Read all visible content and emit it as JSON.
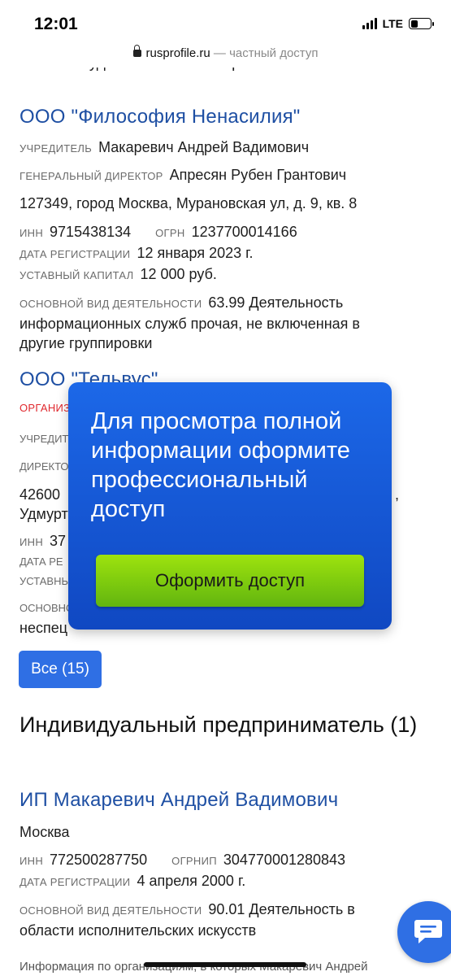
{
  "status_bar": {
    "time": "12:01",
    "network": "LTE",
    "battery_level": 0.35
  },
  "browser": {
    "domain": "rusprofile.ru",
    "separator": " — ",
    "access": "частный доступ"
  },
  "cut_text": "области художественного творчества",
  "companies": [
    {
      "title": "ООО \"Философия Ненасилия\"",
      "founder_label": "Учредитель",
      "founder": "Макаревич Андрей Вадимович",
      "director_label": "Генеральный директор",
      "director": "Апресян Рубен Грантович",
      "address": "127349, город Москва, Мурановская ул, д. 9, кв. 8",
      "inn_label": "ИНН",
      "inn": "9715438134",
      "ogrn_label": "ОГРН",
      "ogrn": "1237700014166",
      "reg_label": "Дата регистрации",
      "reg_date": "12 января 2023 г.",
      "capital_label": "Уставный капитал",
      "capital": "12 000 руб.",
      "activity_label": "Основной вид деятельности",
      "activity_line1": "63.99 Деятельность",
      "activity_line2": "информационных служб прочая, не включенная в",
      "activity_line3": "другие группировки"
    },
    {
      "title": "ООО \"Тельвус\"",
      "status_partial": "ОРГАНИЗ",
      "founder_partial": "УЧРЕДИТ",
      "director_partial": "ДИРЕКТО",
      "address_partial_1": "42600",
      "address_partial_2": "Удмурт",
      "address_tail": ",",
      "inn_label": "ИНН",
      "inn_partial": "37",
      "reg_partial": "ДАТА РЕ",
      "capital_partial": "УСТАВНЫ",
      "activity_partial": "ОСНОВНО",
      "activity_line_partial": "неспец"
    }
  ],
  "paywall": {
    "message": "Для просмотра полной информации оформите профессиональный доступ",
    "button": "Оформить доступ"
  },
  "all_button": "Все (15)",
  "ip_section": {
    "heading": "Индивидуальный предприниматель (1)",
    "title": "ИП Макаревич Андрей Вадимович",
    "city": "Москва",
    "inn_label": "ИНН",
    "inn": "772500287750",
    "ogrnip_label": "ОГРНИП",
    "ogrnip": "304770001280843",
    "reg_label": "Дата регистрации",
    "reg_date": "4 апреля 2000 г.",
    "activity_label": "Основной вид деятельности",
    "activity_line1": "90.01 Деятельность в",
    "activity_line2": "области исполнительских искусств"
  },
  "footer": "Информация по организациям, в которых Макаревич Андрей"
}
